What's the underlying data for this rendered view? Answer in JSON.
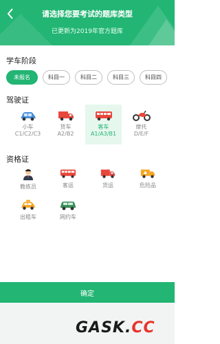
{
  "header": {
    "title": "请选择您要考试的题库类型",
    "subtitle": "已更新为2019年官方题库"
  },
  "stage": {
    "title": "学车阶段",
    "chips": [
      "未报名",
      "科目一",
      "科目二",
      "科目三",
      "科目四"
    ],
    "selected_index": 0
  },
  "license": {
    "title": "驾驶证",
    "items": [
      {
        "name": "小车",
        "code": "C1/C2/C3",
        "icon": "car-icon"
      },
      {
        "name": "货车",
        "code": "A2/B2",
        "icon": "truck-icon"
      },
      {
        "name": "客车",
        "code": "A1/A3/B1",
        "icon": "bus-icon"
      },
      {
        "name": "摩托",
        "code": "D/E/F",
        "icon": "motorcycle-icon"
      }
    ],
    "selected_index": 2
  },
  "qualification": {
    "title": "资格证",
    "items": [
      {
        "name": "教练员",
        "icon": "instructor-icon"
      },
      {
        "name": "客运",
        "icon": "bus-icon"
      },
      {
        "name": "货运",
        "icon": "truck-icon"
      },
      {
        "name": "危险品",
        "icon": "hazmat-truck-icon"
      },
      {
        "name": "出租车",
        "icon": "taxi-icon"
      },
      {
        "name": "网约车",
        "icon": "ride-hailing-car-icon"
      }
    ]
  },
  "confirm_label": "确定",
  "watermark": {
    "main": "GASK.",
    "accent": "CC"
  },
  "colors": {
    "accent": "#22b573",
    "selected_bg": "#e6f7ee"
  }
}
